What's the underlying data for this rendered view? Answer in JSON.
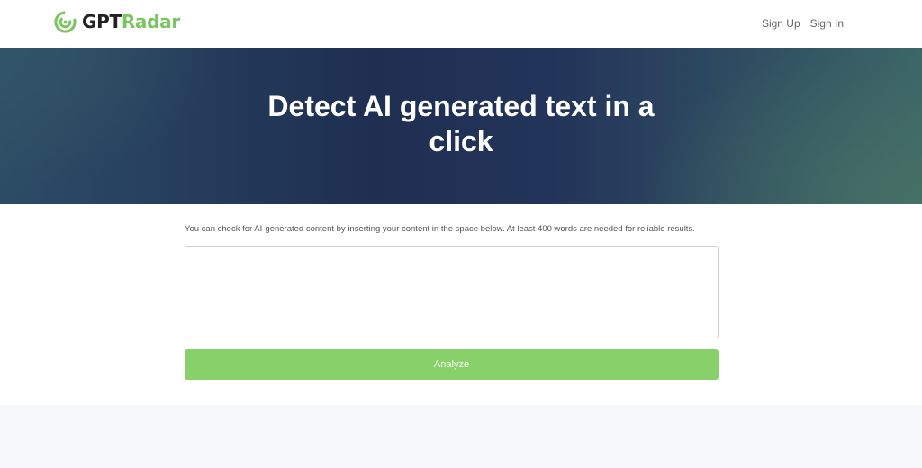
{
  "header": {
    "logo": {
      "part1": "GPT",
      "part2": "Radar"
    },
    "nav": {
      "signup": "Sign Up",
      "signin": "Sign In"
    }
  },
  "hero": {
    "title": "Detect AI generated text in a click"
  },
  "main": {
    "instructions": "You can check for AI-generated content by inserting your content in the space below. At least 400 words are needed for reliable results.",
    "textarea": {
      "value": "",
      "placeholder": ""
    },
    "analyze_label": "Analyze"
  },
  "colors": {
    "brand_green": "#79c55f",
    "button_green": "#88d06a",
    "hero_dark": "#1f2f52",
    "hero_teal": "#3a6468"
  },
  "icons": {
    "logo": "radar-icon"
  }
}
